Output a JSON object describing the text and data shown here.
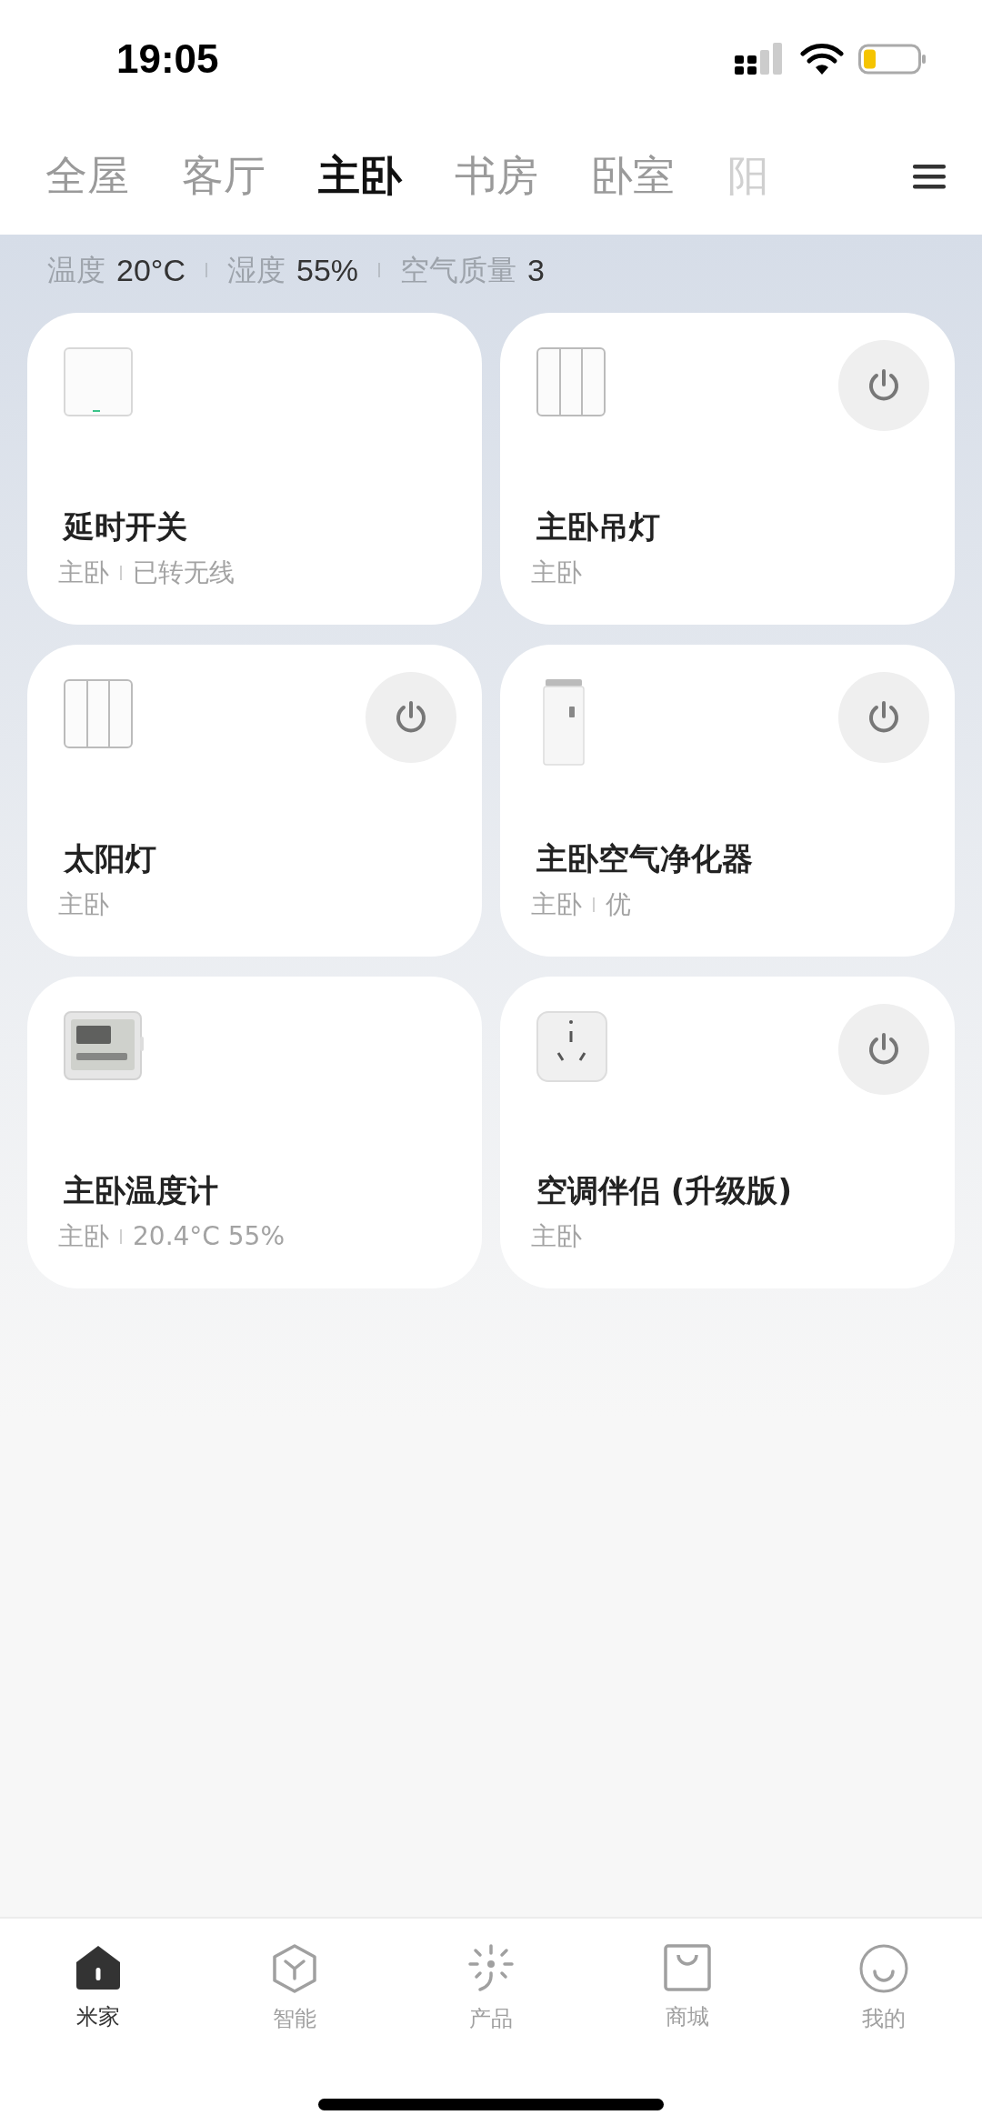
{
  "status_bar": {
    "time": "19:05"
  },
  "room_tabs": [
    {
      "label": "全屋",
      "selected": false
    },
    {
      "label": "客厅",
      "selected": false
    },
    {
      "label": "主卧",
      "selected": true
    },
    {
      "label": "书房",
      "selected": false
    },
    {
      "label": "卧室",
      "selected": false
    },
    {
      "label": "阳",
      "selected": false
    }
  ],
  "environment": [
    {
      "label": "温度",
      "value": "20°C"
    },
    {
      "label": "湿度",
      "value": "55%"
    },
    {
      "label": "空气质量",
      "value": "3"
    }
  ],
  "devices": [
    {
      "kind": "single-switch",
      "name": "延时开关",
      "room": "主卧",
      "status": "已转无线",
      "power_button": false
    },
    {
      "kind": "triple-switch",
      "name": "主卧吊灯",
      "room": "主卧",
      "power_button": true
    },
    {
      "kind": "triple-switch",
      "name": "太阳灯",
      "room": "主卧",
      "power_button": true
    },
    {
      "kind": "purifier",
      "name": "主卧空气净化器",
      "room": "主卧",
      "status": "优",
      "power_button": true
    },
    {
      "kind": "thermometer",
      "name": "主卧温度计",
      "room": "主卧",
      "status": "20.4°C 55%",
      "power_button": false
    },
    {
      "kind": "plug",
      "name": "空调伴侣 (升级版)",
      "room": "主卧",
      "power_button": true
    }
  ],
  "bottom_nav": [
    {
      "kind": "home",
      "label": "米家",
      "selected": true
    },
    {
      "kind": "smart",
      "label": "智能",
      "selected": false
    },
    {
      "kind": "products",
      "label": "产品",
      "selected": false
    },
    {
      "kind": "store",
      "label": "商城",
      "selected": false
    },
    {
      "kind": "profile",
      "label": "我的",
      "selected": false
    }
  ]
}
